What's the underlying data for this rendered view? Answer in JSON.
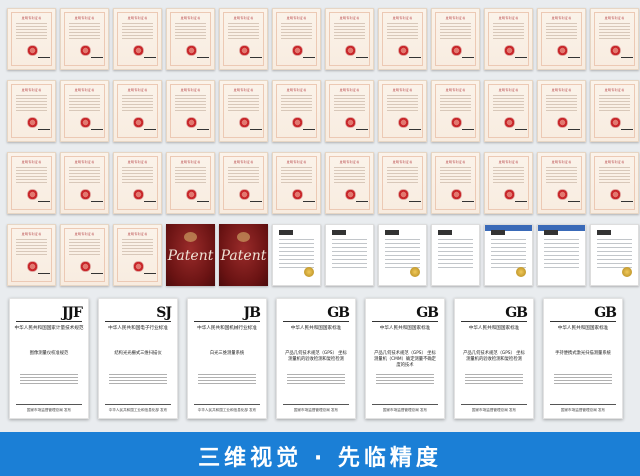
{
  "certificate_wall": {
    "row_count": 4,
    "cert_title": "发明专利证书",
    "misc_items": [
      {
        "kind": "patent",
        "word": "Patent"
      },
      {
        "kind": "patent",
        "word": "Patent"
      },
      {
        "kind": "doc"
      },
      {
        "kind": "doc"
      },
      {
        "kind": "doc"
      },
      {
        "kind": "doc"
      },
      {
        "kind": "doc"
      },
      {
        "kind": "doc"
      },
      {
        "kind": "doc"
      }
    ]
  },
  "standards": [
    {
      "code": "JJF",
      "org": "中华人民共和国国家计量技术规范",
      "title": "图像测量仪校准规范",
      "foot": "国家市场监督管理总局 发布"
    },
    {
      "code": "SJ",
      "org": "中华人民共和国电子行业标准",
      "title": "结构光光栅式三维扫描仪",
      "foot": "中华人民共和国工业和信息化部 发布"
    },
    {
      "code": "JB",
      "org": "中华人民共和国机械行业标准",
      "title": "白光三维测量系统",
      "foot": "中华人民共和国工业和信息化部 发布"
    },
    {
      "code": "GB",
      "org": "中华人民共和国国家标准",
      "title": "产品几何技术规范（GPS） 坐标测量机的验收检测和复检检测",
      "foot": "国家市场监督管理总局 发布"
    },
    {
      "code": "GB",
      "org": "中华人民共和国国家标准",
      "title": "产品几何技术规范（GPS） 坐标测量机（CMM）确定测量不确定度的技术",
      "foot": "国家市场监督管理总局 发布"
    },
    {
      "code": "GB",
      "org": "中华人民共和国国家标准",
      "title": "产品几何技术规范（GPS） 坐标测量机的验收检测和复检检测",
      "foot": "国家市场监督管理总局 发布"
    },
    {
      "code": "GB",
      "org": "中华人民共和国国家标准",
      "title": "手持便携式激光扫描测量系统",
      "foot": "国家市场监督管理总局 发布"
    }
  ],
  "banner": {
    "text": "三维视觉 · 先临精度",
    "color": "#1b7fd6"
  }
}
